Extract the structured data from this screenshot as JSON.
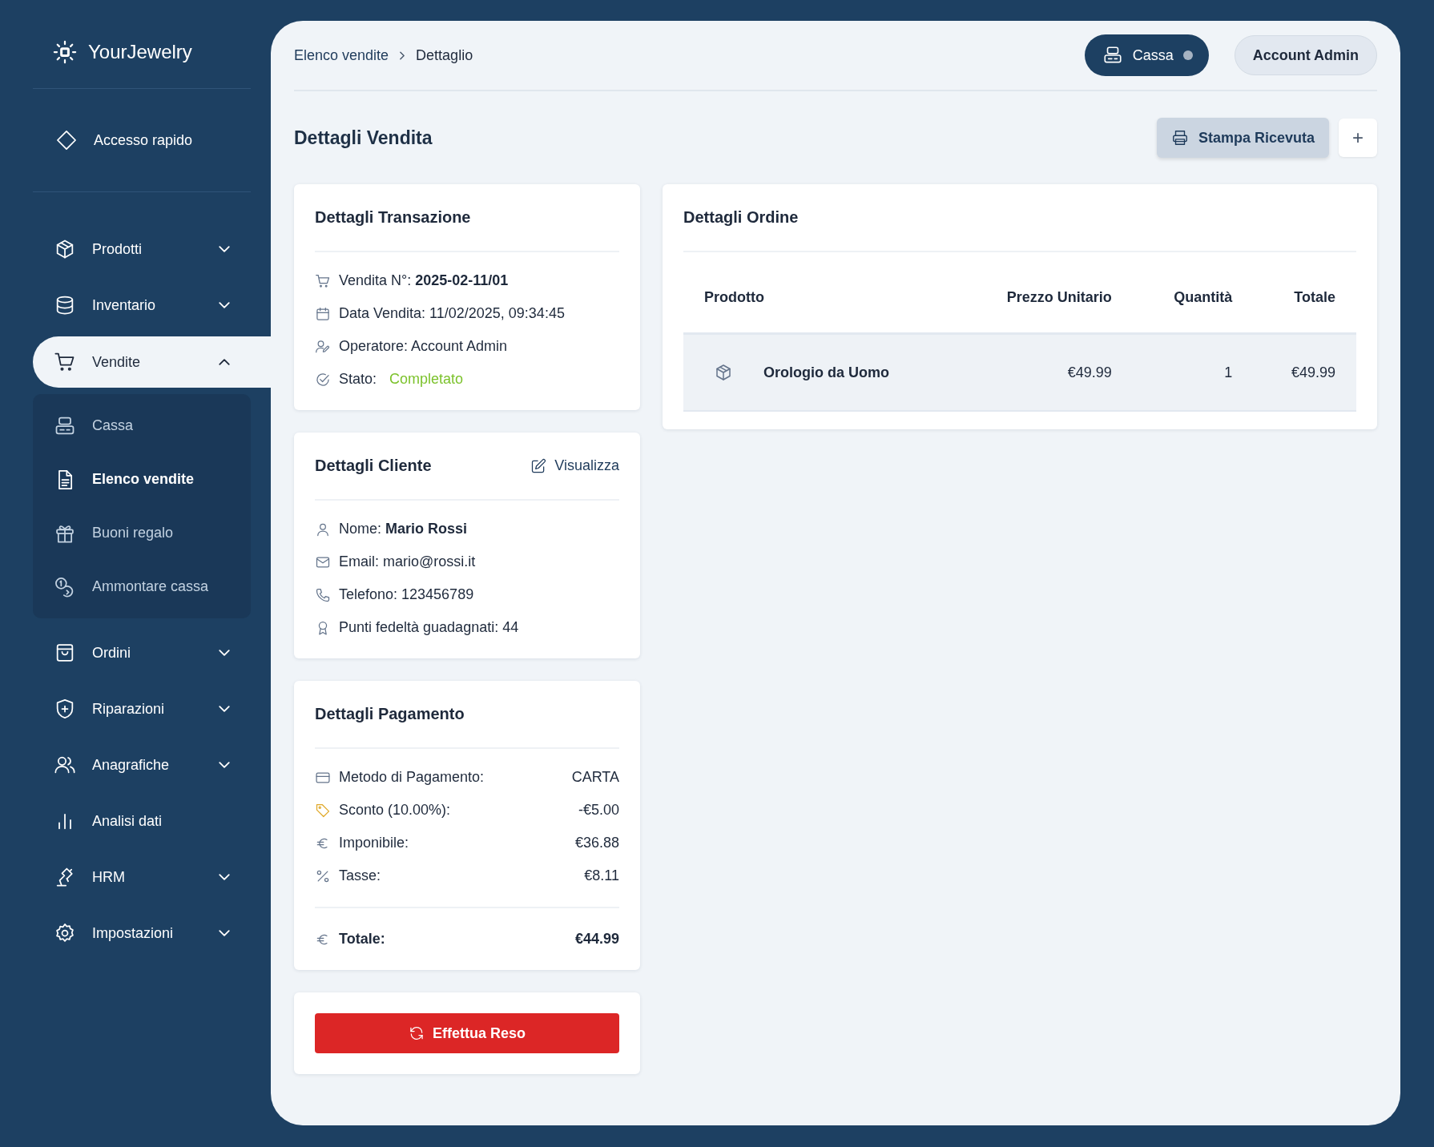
{
  "brand": {
    "name": "YourJewelry"
  },
  "sidebar": {
    "quick_access": {
      "label": "Accesso rapido"
    },
    "items": [
      {
        "label": "Prodotti",
        "kind": "group",
        "expanded": false,
        "selected": false
      },
      {
        "label": "Inventario",
        "kind": "group",
        "expanded": false,
        "selected": false
      },
      {
        "label": "Vendite",
        "kind": "group",
        "expanded": true,
        "selected": true,
        "children": [
          {
            "label": "Cassa",
            "selected": false
          },
          {
            "label": "Elenco vendite",
            "selected": true
          },
          {
            "label": "Buoni regalo",
            "selected": false
          },
          {
            "label": "Ammontare cassa",
            "selected": false
          }
        ]
      },
      {
        "label": "Ordini",
        "kind": "group",
        "expanded": false,
        "selected": false
      },
      {
        "label": "Riparazioni",
        "kind": "group",
        "expanded": false,
        "selected": false
      },
      {
        "label": "Anagrafiche",
        "kind": "group",
        "expanded": false,
        "selected": false
      },
      {
        "label": "Analisi dati",
        "kind": "link",
        "selected": false
      },
      {
        "label": "HRM",
        "kind": "group",
        "expanded": false,
        "selected": false
      },
      {
        "label": "Impostazioni",
        "kind": "group",
        "expanded": false,
        "selected": false
      }
    ]
  },
  "header": {
    "breadcrumb": [
      "Elenco vendite",
      "Dettaglio"
    ],
    "cassa_button": {
      "label": "Cassa",
      "active": false
    },
    "account_button": {
      "label": "Account Admin"
    }
  },
  "page": {
    "title": "Dettagli Vendita",
    "actions": [
      {
        "label": "Stampa Ricevuta",
        "kind": "print"
      },
      {
        "label": "+",
        "kind": "add"
      }
    ]
  },
  "transaction": {
    "title": "Dettagli Transazione",
    "rows": [
      {
        "kind": "text",
        "text": "Vendita N°: **2025-02-11/01**"
      },
      {
        "kind": "text",
        "text": "Data Vendita: 11/02/2025, 09:34:45"
      },
      {
        "kind": "text",
        "text": "Operatore: Account Admin"
      },
      {
        "kind": "status",
        "label": "Stato:",
        "value": "Completato"
      }
    ]
  },
  "customer": {
    "title": "Dettagli Cliente",
    "link": "Visualizza",
    "rows": [
      "Nome: **Mario Rossi**",
      "Email: mario@rossi.it",
      "Telefono: 123456789",
      "Punti fedeltà guadagnati: 44"
    ]
  },
  "payment": {
    "title": "Dettagli Pagamento",
    "rows": [
      {
        "label": "Metodo di Pagamento:",
        "value": "CARTA"
      },
      {
        "label": "Sconto (10.00%):",
        "value": "-€5.00"
      },
      {
        "label": "Imponibile:",
        "value": "€36.88"
      },
      {
        "label": "Tasse:",
        "value": "€8.11"
      }
    ],
    "total": {
      "label": "Totale:",
      "value": "€44.99"
    }
  },
  "return_button": {
    "label": "Effettua Reso"
  },
  "order": {
    "title": "Dettagli Ordine",
    "columns": [
      "Prodotto",
      "Prezzo Unitario",
      "Quantità",
      "Totale"
    ],
    "rows": [
      {
        "product": "Orologio da Uomo",
        "unit_price": "€49.99",
        "quantity": "1",
        "total": "€49.99"
      }
    ]
  }
}
